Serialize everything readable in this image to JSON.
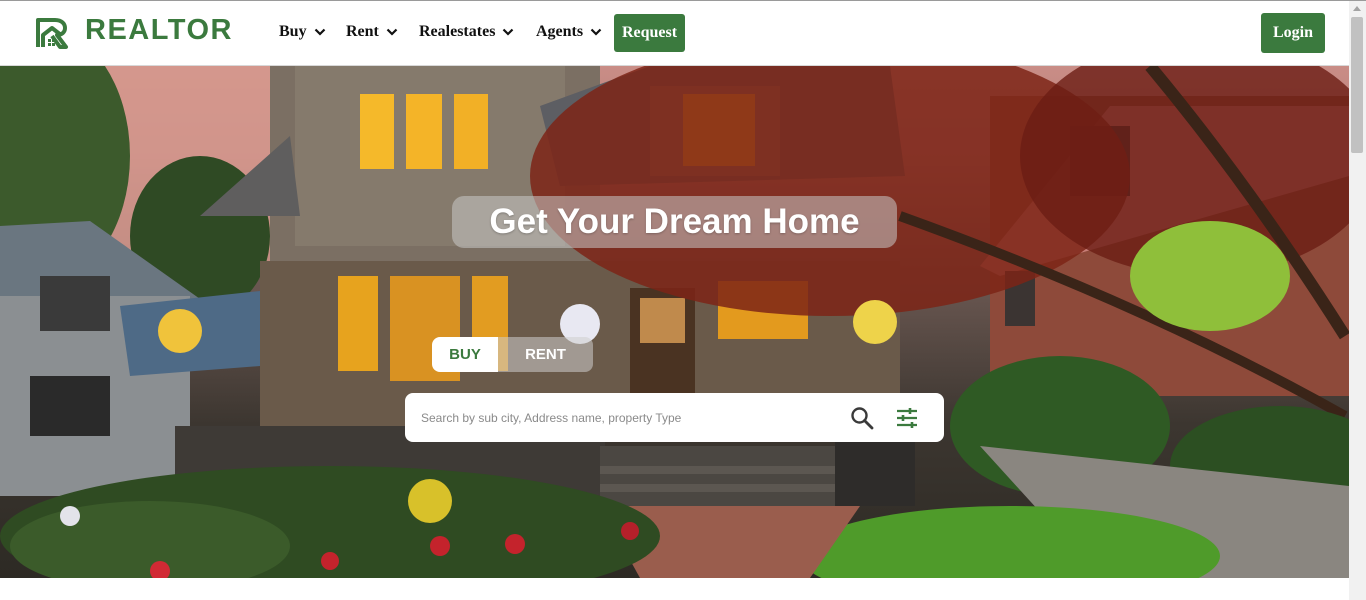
{
  "brand": {
    "name": "REALTOR",
    "logo_icon": "house-r-logo-icon",
    "color": "#3b7a3e"
  },
  "nav": {
    "items": [
      {
        "label": "Buy",
        "icon": "chevron-down-icon"
      },
      {
        "label": "Rent",
        "icon": "chevron-down-icon"
      },
      {
        "label": "Realestates",
        "icon": "chevron-down-icon"
      },
      {
        "label": "Agents",
        "icon": "chevron-down-icon"
      }
    ],
    "request_label": "Request",
    "login_label": "Login"
  },
  "hero": {
    "title": "Get Your Dream Home",
    "tabs": {
      "buy": "BUY",
      "rent": "RENT",
      "active": "BUY"
    },
    "search": {
      "value": "",
      "placeholder": "Search by sub city, Address name, property Type",
      "search_icon": "search-icon",
      "filter_icon": "sliders-filter-icon"
    }
  }
}
